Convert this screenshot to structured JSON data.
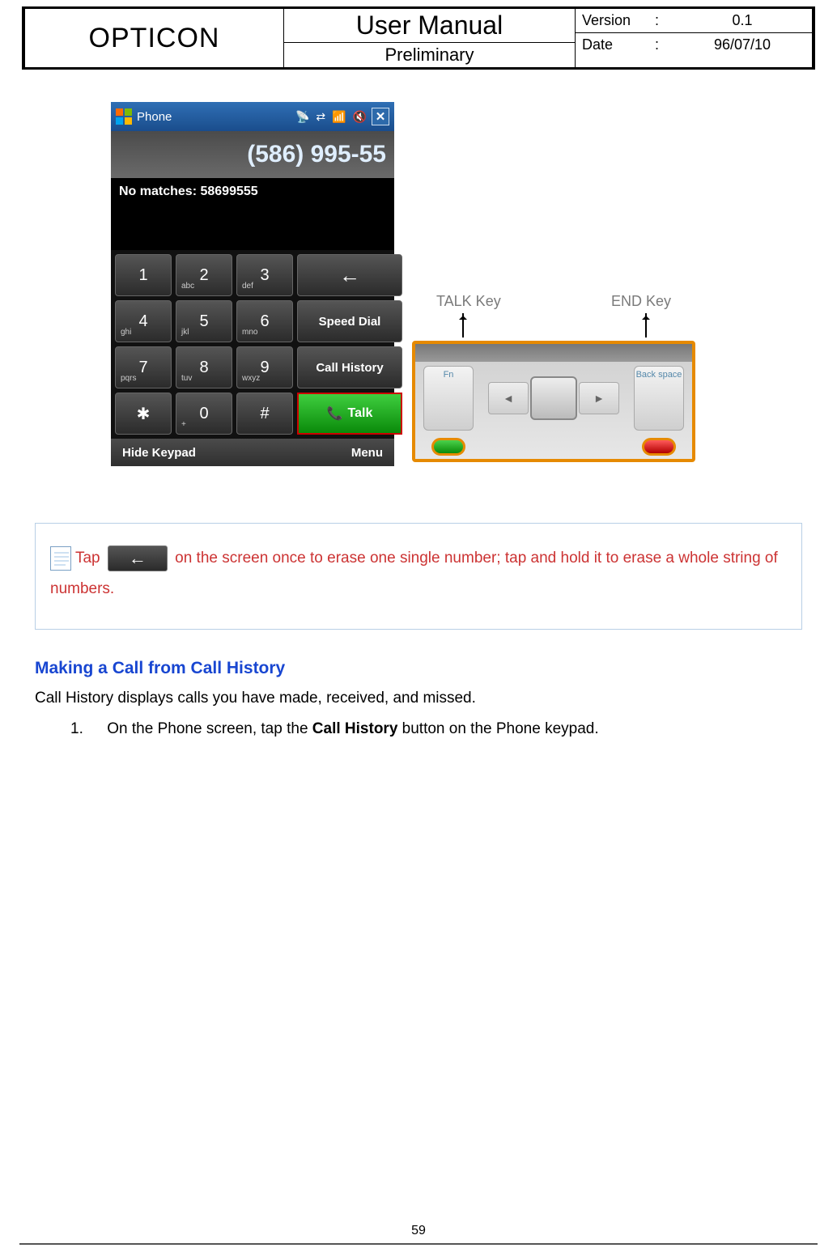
{
  "header": {
    "brand": "OPTICON",
    "title": "User Manual",
    "subtitle": "Preliminary",
    "version_label": "Version",
    "version_value": "0.1",
    "date_label": "Date",
    "date_value": "96/07/10",
    "colon": ":"
  },
  "phone": {
    "title": "Phone",
    "number_display": "(586) 995-55",
    "no_matches": "No matches: 58699555",
    "keys": {
      "k1": "1",
      "k2": "2",
      "k2sub": "abc",
      "k3": "3",
      "k3sub": "def",
      "k4": "4",
      "k4sub": "ghi",
      "k5": "5",
      "k5sub": "jkl",
      "k6": "6",
      "k6sub": "mno",
      "k7": "7",
      "k7sub": "pqrs",
      "k8": "8",
      "k8sub": "tuv",
      "k9": "9",
      "k9sub": "wxyz",
      "kstar": "✱",
      "k0": "0",
      "k0sub": "+",
      "kpound": "#",
      "backspace": "←",
      "speed_dial": "Speed Dial",
      "call_history": "Call History",
      "talk": "Talk"
    },
    "softkeys": {
      "left": "Hide Keypad",
      "right": "Menu"
    },
    "icons": {
      "close": "✕",
      "signal": "📶",
      "speaker": "🔇",
      "sync": "⇄",
      "wifi": "📡"
    }
  },
  "hw": {
    "talk_label": "TALK Key",
    "end_label": "END Key",
    "fn_label": "Fn",
    "bk_label": "Back space",
    "left": "◄",
    "right": "►"
  },
  "tip": {
    "pre": "Tap",
    "arrow": "←",
    "post": "on the screen once to erase one single number; tap and hold it to erase a whole string of numbers."
  },
  "section": {
    "title": "Making a Call from Call History",
    "intro": "Call History displays calls you have made, received, and missed.",
    "step1_num": "1.",
    "step1a": "On the Phone screen, tap the ",
    "step1b": "Call History",
    "step1c": " button on the Phone keypad."
  },
  "page_number": "59"
}
